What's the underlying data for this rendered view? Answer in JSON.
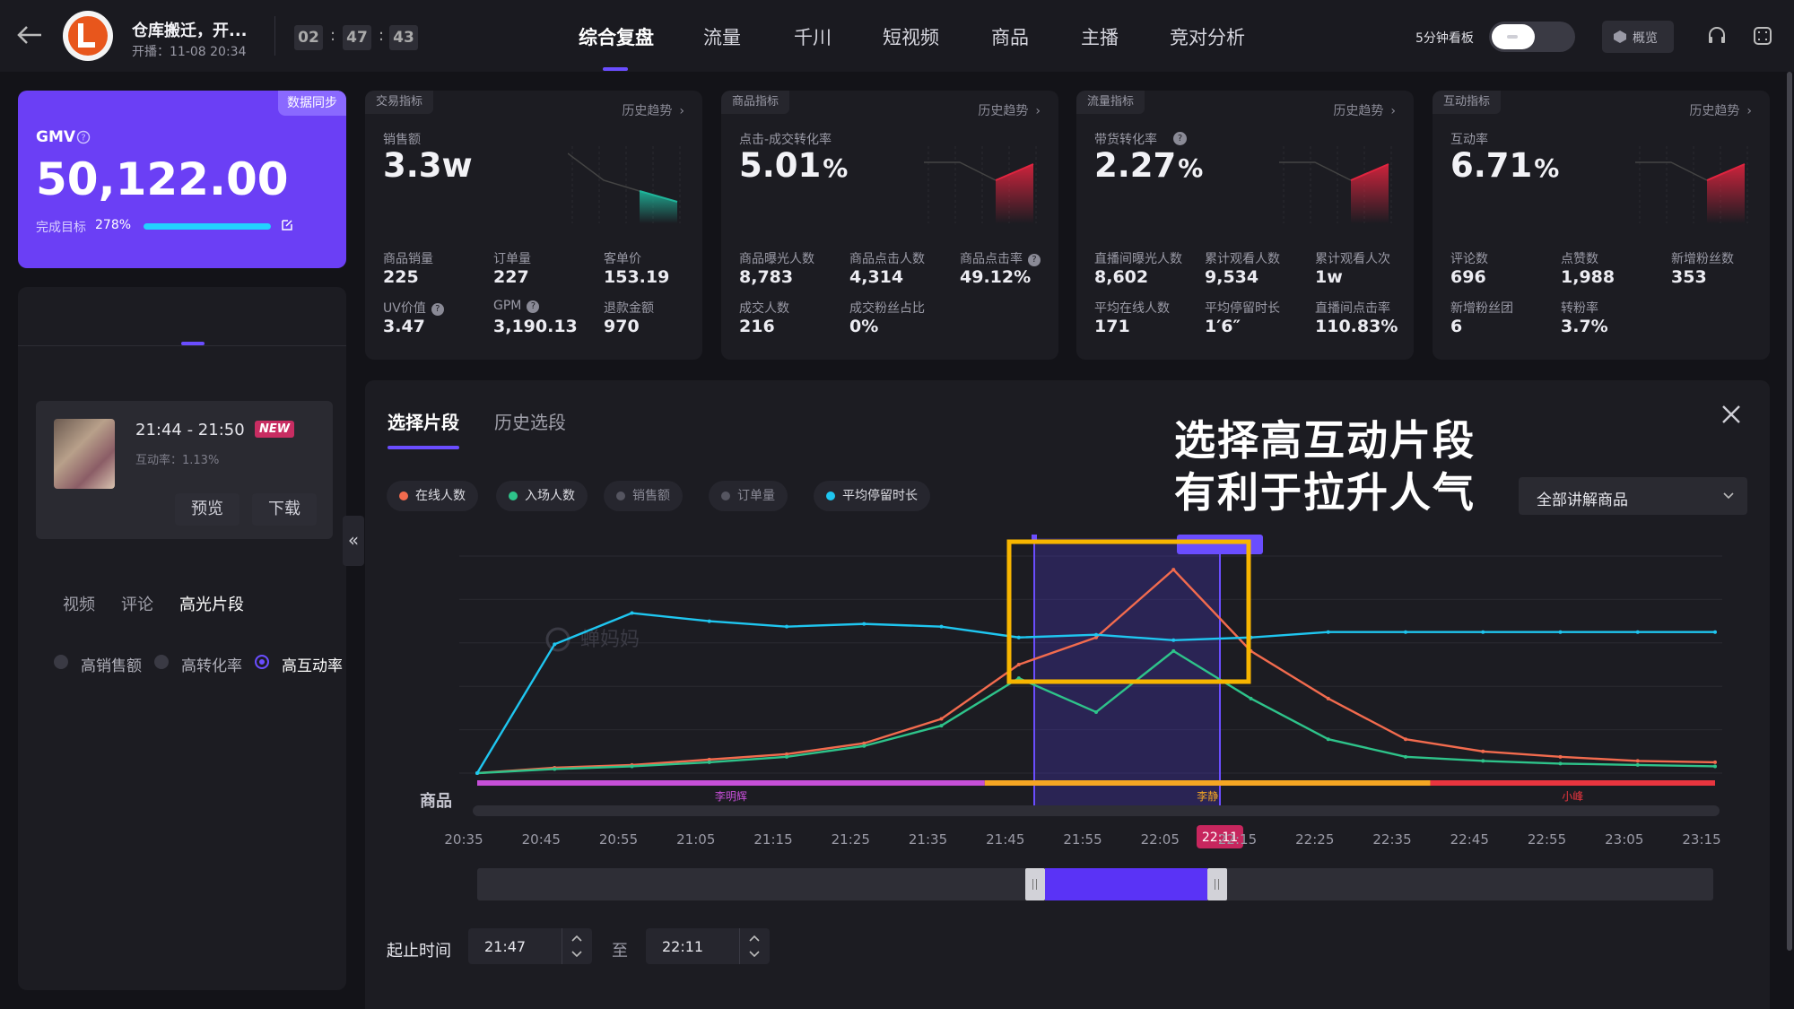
{
  "header": {
    "title": "仓库搬迁，开...",
    "start_label": "开播：11-08 20:34",
    "time": [
      "02",
      "47",
      "43"
    ],
    "time_sep": ":",
    "nav": [
      "综合复盘",
      "流量",
      "千川",
      "短视频",
      "商品",
      "主播",
      "竞对分析"
    ],
    "active_nav": 0,
    "board_label": "5分钟看板",
    "overview_label": "概览"
  },
  "gmv": {
    "sync_label": "数据同步",
    "label": "GMV",
    "value": "50,122.00",
    "target_label": "完成目标",
    "target_pct": "278%",
    "progress": 1.0
  },
  "left_panel": {
    "tabs": [
      "视频",
      "评论",
      "高光片段"
    ],
    "active_tab": 2,
    "radios": [
      "高销售额",
      "高转化率",
      "高互动率"
    ],
    "selected_radio": 2,
    "clip": {
      "time_range": "21:44 - 21:50",
      "badge": "NEW",
      "rate_label": "互动率：1.13%",
      "preview_label": "预览",
      "download_label": "下载"
    }
  },
  "metric_cards": [
    {
      "tag": "交易指标",
      "trend": "历史趋势",
      "main_label": "销售额",
      "main_value": "3.3w",
      "main_unit": "",
      "spark_color": "#1fb59a",
      "items": [
        {
          "label": "商品销量",
          "value": "225"
        },
        {
          "label": "订单量",
          "value": "227"
        },
        {
          "label": "客单价",
          "value": "153.19"
        },
        {
          "label": "UV价值",
          "value": "3.47"
        },
        {
          "label": "GPM",
          "value": "3,190.13"
        },
        {
          "label": "退款金额",
          "value": "970"
        }
      ]
    },
    {
      "tag": "商品指标",
      "trend": "历史趋势",
      "main_label": "点击-成交转化率",
      "main_value": "5.01",
      "main_unit": "%",
      "spark_color": "#e0243f",
      "items": [
        {
          "label": "商品曝光人数",
          "value": "8,783"
        },
        {
          "label": "商品点击人数",
          "value": "4,314"
        },
        {
          "label": "商品点击率",
          "value": "49.12%"
        },
        {
          "label": "成交人数",
          "value": "216"
        },
        {
          "label": "成交粉丝占比",
          "value": "0%"
        }
      ]
    },
    {
      "tag": "流量指标",
      "trend": "历史趋势",
      "main_label": "带货转化率",
      "main_value": "2.27",
      "main_unit": "%",
      "spark_color": "#e0243f",
      "items": [
        {
          "label": "直播间曝光人数",
          "value": "8,602"
        },
        {
          "label": "累计观看人数",
          "value": "9,534"
        },
        {
          "label": "累计观看人次",
          "value": "1w"
        },
        {
          "label": "平均在线人数",
          "value": "171"
        },
        {
          "label": "平均停留时长",
          "value": "1′6″"
        },
        {
          "label": "直播间点击率",
          "value": "110.83%"
        }
      ]
    },
    {
      "tag": "互动指标",
      "trend": "历史趋势",
      "main_label": "互动率",
      "main_value": "6.71",
      "main_unit": "%",
      "spark_color": "#e0243f",
      "items": [
        {
          "label": "评论数",
          "value": "696"
        },
        {
          "label": "点赞数",
          "value": "1,988"
        },
        {
          "label": "新增粉丝数",
          "value": "353"
        },
        {
          "label": "新增粉丝团",
          "value": "6"
        },
        {
          "label": "转粉率",
          "value": "3.7%"
        }
      ]
    }
  ],
  "segment_panel": {
    "tabs": [
      "选择片段",
      "历史选段"
    ],
    "active_tab": 0,
    "overlay_line1": "选择高互动片段",
    "overlay_line2": "有利于拉升人气",
    "dropdown_value": "全部讲解商品",
    "legend": [
      {
        "label": "在线人数",
        "color": "#f26b4e",
        "active": true
      },
      {
        "label": "入场人数",
        "color": "#2ec38a",
        "active": true
      },
      {
        "label": "销售额",
        "color": "#555560",
        "active": false
      },
      {
        "label": "订单量",
        "color": "#555560",
        "active": false
      },
      {
        "label": "平均停留时长",
        "color": "#1fc6f0",
        "active": true
      }
    ],
    "watermark": "蝉妈妈",
    "product_label": "商品",
    "product_segments": [
      {
        "name": "李明辉",
        "color": "#c64fd8",
        "from": 0,
        "to": 0.41
      },
      {
        "name": "李静",
        "color": "#f5a623",
        "from": 0.41,
        "to": 0.77
      },
      {
        "name": "小峰",
        "color": "#e8353f",
        "from": 0.77,
        "to": 1.0
      }
    ],
    "marker_time": "22:11",
    "time_range_label": "起止时间",
    "start_time": "21:47",
    "to_label": "至",
    "end_time": "22:11"
  },
  "chart_data": {
    "type": "line",
    "x": [
      "20:35",
      "20:45",
      "20:55",
      "21:05",
      "21:15",
      "21:25",
      "21:35",
      "21:45",
      "21:55",
      "22:05",
      "22:15",
      "22:25",
      "22:35",
      "22:45",
      "22:55",
      "23:05",
      "23:15"
    ],
    "selection": [
      "21:47",
      "22:11"
    ],
    "series": [
      {
        "name": "在线人数",
        "color": "#f26b4e",
        "values": [
          0,
          4,
          6,
          10,
          14,
          22,
          40,
          80,
          100,
          150,
          90,
          55,
          25,
          16,
          12,
          9,
          8
        ]
      },
      {
        "name": "入场人数",
        "color": "#2ec38a",
        "values": [
          0,
          3,
          5,
          8,
          12,
          20,
          35,
          70,
          45,
          90,
          55,
          25,
          12,
          9,
          7,
          6,
          5
        ]
      },
      {
        "name": "平均停留时长",
        "color": "#1fc6f0",
        "values": [
          0,
          95,
          118,
          112,
          108,
          110,
          108,
          100,
          102,
          98,
          100,
          104,
          104,
          104,
          104,
          104,
          104
        ]
      }
    ]
  }
}
